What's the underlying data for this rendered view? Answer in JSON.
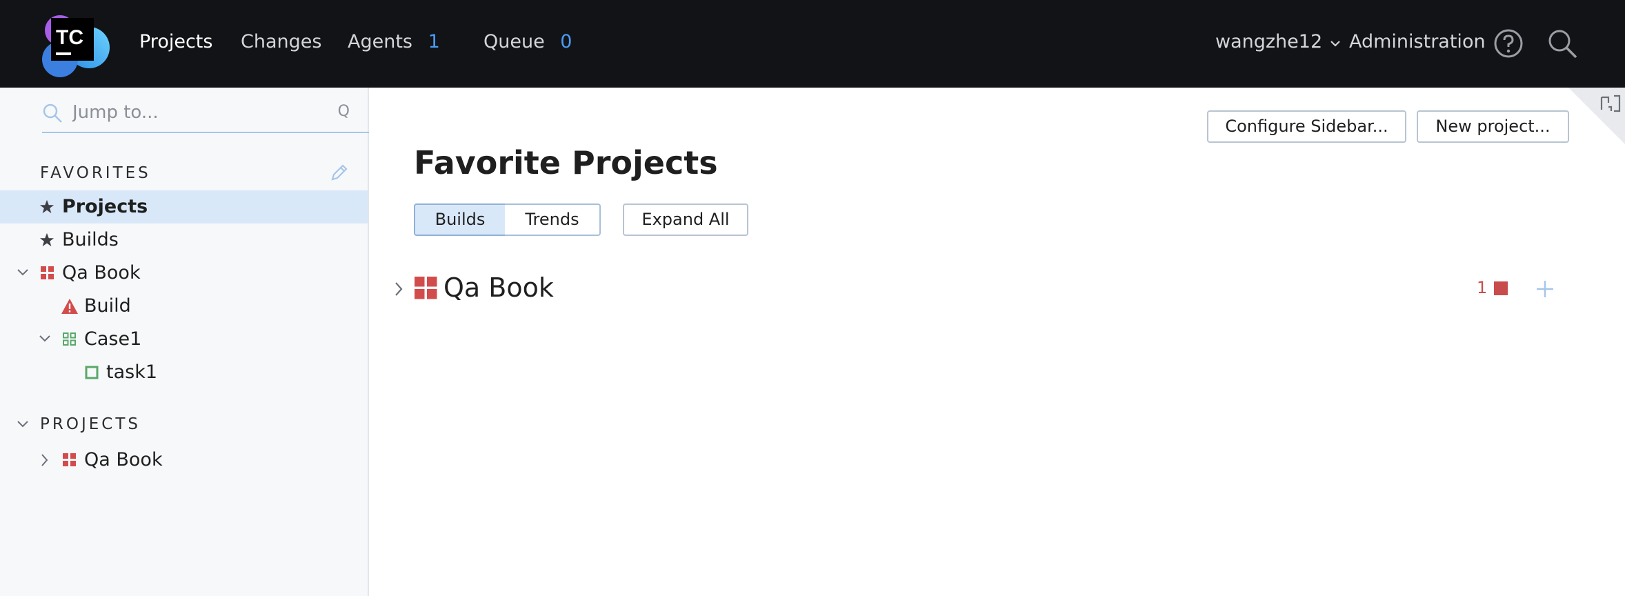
{
  "header": {
    "logo_text": "TC",
    "nav": [
      {
        "label": "Projects"
      },
      {
        "label": "Changes"
      },
      {
        "label": "Agents",
        "count": "1"
      },
      {
        "label": "Queue",
        "count": "0"
      }
    ],
    "user": "wangzhe12",
    "admin": "Administration",
    "icons": {
      "help": "help-circle-icon",
      "search": "search-icon"
    }
  },
  "sidebar": {
    "search": {
      "placeholder": "Jump to...",
      "shortcut": "Q"
    },
    "favorites_label": "FAVORITES",
    "favorites": [
      {
        "label": "Projects",
        "icon": "star-icon"
      },
      {
        "label": "Builds",
        "icon": "star-icon"
      },
      {
        "label": "Qa Book",
        "icon": "project-red-icon"
      },
      {
        "label": "Build",
        "icon": "warning-icon"
      },
      {
        "label": "Case1",
        "icon": "project-green-icon"
      },
      {
        "label": "task1",
        "icon": "build-config-icon"
      }
    ],
    "projects_label": "PROJECTS",
    "projects": [
      {
        "label": "Qa Book",
        "icon": "project-red-icon"
      }
    ]
  },
  "main": {
    "configure_label": "Configure Sidebar...",
    "new_project_label": "New project...",
    "title": "Favorite Projects",
    "tabs": [
      "Builds",
      "Trends"
    ],
    "expand_all": "Expand All",
    "project": {
      "name": "Qa Book",
      "failed_count": "1"
    }
  },
  "colors": {
    "header_bg": "#121316",
    "accent_blue": "#4a9cf5",
    "failed_red": "#c84c4c",
    "success_green": "#59a869",
    "selected_bg": "#d9e8f9"
  }
}
